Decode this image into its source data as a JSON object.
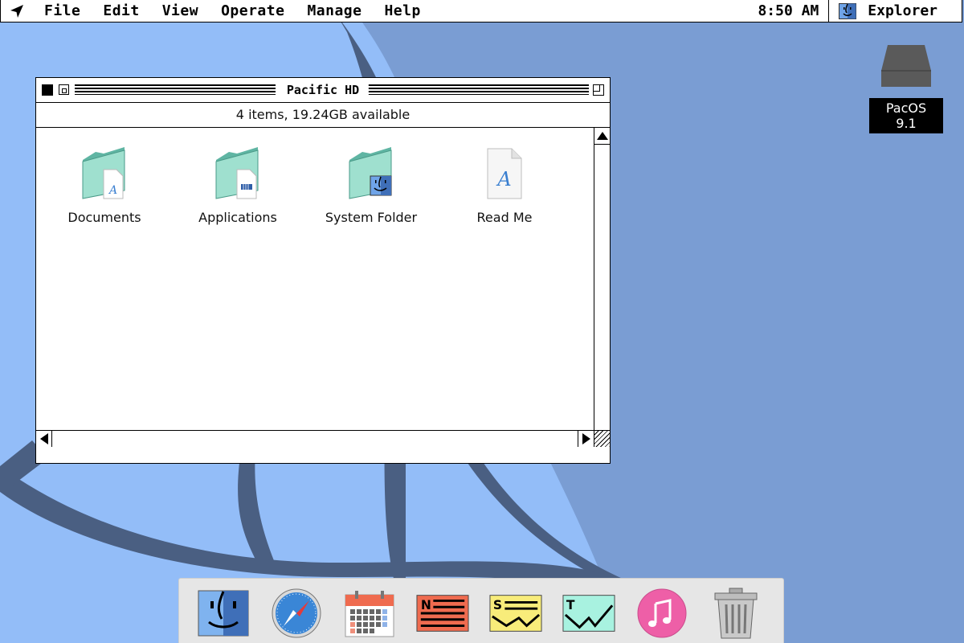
{
  "menubar": {
    "items": [
      "File",
      "Edit",
      "View",
      "Operate",
      "Manage",
      "Help"
    ],
    "clock": "8:50 AM",
    "active_app": "Explorer"
  },
  "window": {
    "title": "Pacific HD",
    "info": "4 items, 19.24GB available",
    "items": [
      {
        "label": "Documents",
        "icon": "documents-folder-icon"
      },
      {
        "label": "Applications",
        "icon": "applications-folder-icon"
      },
      {
        "label": "System Folder",
        "icon": "system-folder-icon"
      },
      {
        "label": "Read Me",
        "icon": "text-document-icon"
      }
    ]
  },
  "desktop": {
    "disk_label": "PacOS 9.1"
  },
  "dock": {
    "items": [
      "finder-icon",
      "safari-compass-icon",
      "calendar-icon",
      "news-app-icon",
      "stocks-app-icon",
      "trends-app-icon",
      "music-icon",
      "trash-icon"
    ]
  },
  "colors": {
    "desktop": "#93bdf8",
    "desktop_shade": "#7a9dd3",
    "swoosh": "#4a5f82",
    "folder": "#7fcfbd"
  }
}
